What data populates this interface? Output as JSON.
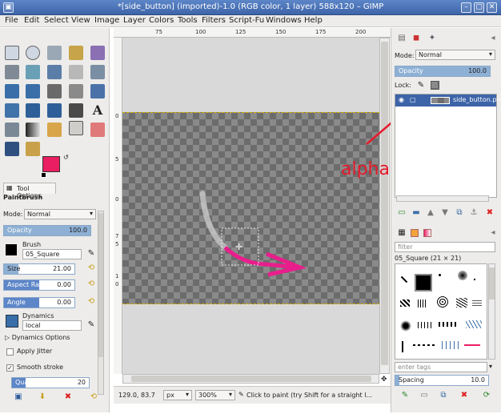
{
  "window": {
    "title": "*[side_button] (imported)-1.0 (RGB color, 1 layer) 588x120 – GIMP"
  },
  "menu": [
    "File",
    "Edit",
    "Select",
    "View",
    "Image",
    "Layer",
    "Colors",
    "Tools",
    "Filters",
    "Script-Fu",
    "Windows",
    "Help"
  ],
  "tool_options": {
    "tab_label": "Tool Options",
    "tool_name": "Paintbrush",
    "mode_label": "Mode:",
    "mode_value": "Normal",
    "opacity_label": "Opacity",
    "opacity_value": "100.0",
    "brush_label": "Brush",
    "brush_value": "05_Square",
    "size_label": "Size",
    "size_value": "21.00",
    "aspect_label": "Aspect Ratio",
    "aspect_value": "0.00",
    "angle_label": "Angle",
    "angle_value": "0.00",
    "dynamics_label": "Dynamics",
    "dynamics_value": "local",
    "dynamics_options": "Dynamics Options",
    "apply_jitter": "Apply Jitter",
    "smooth_stroke": "Smooth stroke",
    "quality_label": "Quality",
    "quality_value": "20"
  },
  "rulers": {
    "top": [
      "75",
      "100",
      "125",
      "150",
      "175",
      "200"
    ],
    "left": [
      "0",
      "5",
      "0",
      "7",
      "5",
      "1",
      "0"
    ]
  },
  "annotation": {
    "text": "alpha lock",
    "color": "#e8192c"
  },
  "colors": {
    "foreground": "#e91e63",
    "background": "#ffffff",
    "stroke": "#e91e8c",
    "accent": "#3d64a8"
  },
  "status": {
    "coords": "129.0, 83.7",
    "unit": "px",
    "zoom": "300%",
    "message": "Click to paint (try Shift for a straight l..."
  },
  "layers": {
    "mode_label": "Mode:",
    "mode_value": "Normal",
    "opacity_label": "Opacity",
    "opacity_value": "100.0",
    "lock_label": "Lock:",
    "layer_name": "side_button.pn"
  },
  "brushes": {
    "filter_placeholder": "filter",
    "brush_name": "05_Square (21 × 21)",
    "tags_placeholder": "enter tags",
    "spacing_label": "Spacing",
    "spacing_value": "10.0"
  }
}
